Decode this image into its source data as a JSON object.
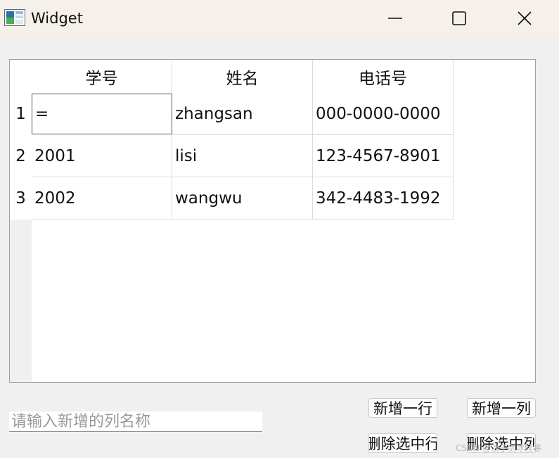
{
  "window": {
    "title": "Widget",
    "icon": "app-window-icon",
    "controls": [
      "minimize-icon",
      "maximize-icon",
      "close-icon"
    ]
  },
  "table": {
    "headers": [
      "学号",
      "姓名",
      "电话号"
    ],
    "row_numbers": [
      "1",
      "2",
      "3"
    ],
    "rows": [
      [
        "=",
        "zhangsan",
        "000-0000-0000"
      ],
      [
        "2001",
        "lisi",
        "123-4567-8901"
      ],
      [
        "2002",
        "wangwu",
        "342-4483-1992"
      ]
    ],
    "editing_cell": "1,1"
  },
  "input": {
    "placeholder": "请输入新增的列名称",
    "value": ""
  },
  "buttons": {
    "add_row": "新增一行",
    "add_col": "新增一列",
    "del_row": "删除选中行",
    "del_col": "删除选中列"
  },
  "watermark": "CSDN @浪子剑冰倾寒",
  "colors": {
    "titlebar": "#f5f0e9",
    "window_bg": "#f0f0f0",
    "grid_line": "#dcdcdc"
  }
}
